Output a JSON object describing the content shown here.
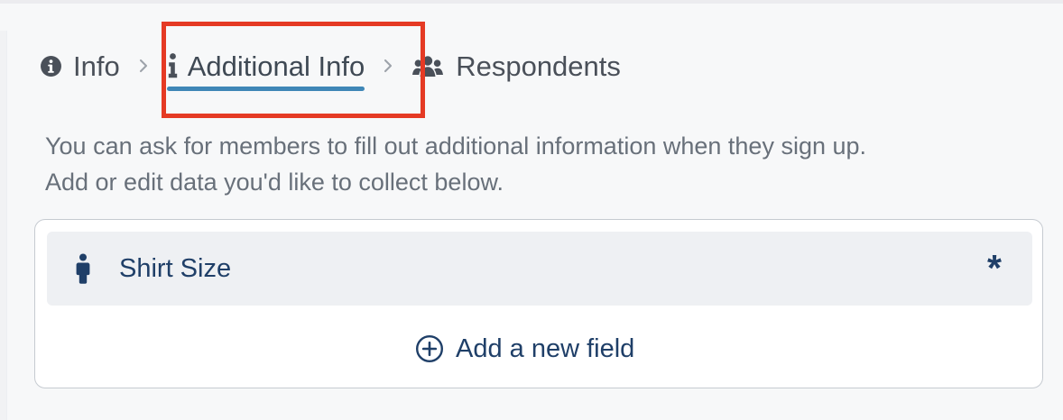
{
  "steps": [
    {
      "label": "Info",
      "icon": "info-circle-icon",
      "active": false
    },
    {
      "label": "Additional Info",
      "icon": "info-icon",
      "active": true
    },
    {
      "label": "Respondents",
      "icon": "users-icon",
      "active": false
    }
  ],
  "intro": {
    "line1": "You can ask for members to fill out additional information when they sign up.",
    "line2": "Add or edit data you'd like to collect below."
  },
  "fields": [
    {
      "label": "Shirt Size",
      "icon": "person-icon",
      "required": true
    }
  ],
  "add_field": {
    "label": "Add a new field",
    "icon": "plus-circle-icon"
  },
  "colors": {
    "active_underline": "#3f87b7",
    "highlight": "#e53a24",
    "field_text": "#1f3f68"
  }
}
